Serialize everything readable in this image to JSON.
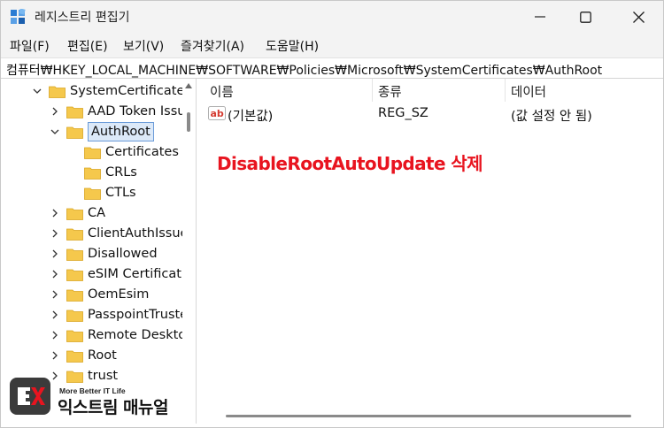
{
  "window": {
    "title": "레지스트리 편집기"
  },
  "menu": {
    "items": [
      "파일(F)",
      "편집(E)",
      "보기(V)",
      "즐겨찾기(A)",
      "도움말(H)"
    ]
  },
  "address": {
    "path": "컴퓨터₩HKEY_LOCAL_MACHINE₩SOFTWARE₩Policies₩Microsoft₩SystemCertificates₩AuthRoot"
  },
  "tree": {
    "items": [
      {
        "label": "SystemCertificates",
        "expanded": true
      },
      {
        "label": "AAD Token Issu",
        "expanded": false
      },
      {
        "label": "AuthRoot",
        "expanded": true,
        "selected": true
      },
      {
        "label": "Certificates"
      },
      {
        "label": "CRLs"
      },
      {
        "label": "CTLs"
      },
      {
        "label": "CA",
        "expanded": false
      },
      {
        "label": "ClientAuthIssuer",
        "expanded": false
      },
      {
        "label": "Disallowed",
        "expanded": false
      },
      {
        "label": "eSIM Certificatio",
        "expanded": false
      },
      {
        "label": "OemEsim",
        "expanded": false
      },
      {
        "label": "PasspointTruste",
        "expanded": false
      },
      {
        "label": "Remote Deskto",
        "expanded": false
      },
      {
        "label": "Root",
        "expanded": false
      },
      {
        "label": "trust",
        "expanded": false
      }
    ]
  },
  "list": {
    "columns": [
      "이름",
      "종류",
      "데이터"
    ],
    "rows": [
      {
        "name": "(기본값)",
        "type": "REG_SZ",
        "data": "(값 설정 안 됨)",
        "icon": "string-value-icon"
      }
    ]
  },
  "annotation": {
    "text": "DisableRootAutoUpdate 삭제",
    "color": "#e8141f"
  },
  "watermark": {
    "tagline": "More Better IT Life",
    "brand": "익스트림 매뉴얼"
  },
  "colors": {
    "selection_border": "#6a9bd8",
    "selection_fill": "#dce9f8",
    "folder_yellow": "#f5c84c"
  }
}
